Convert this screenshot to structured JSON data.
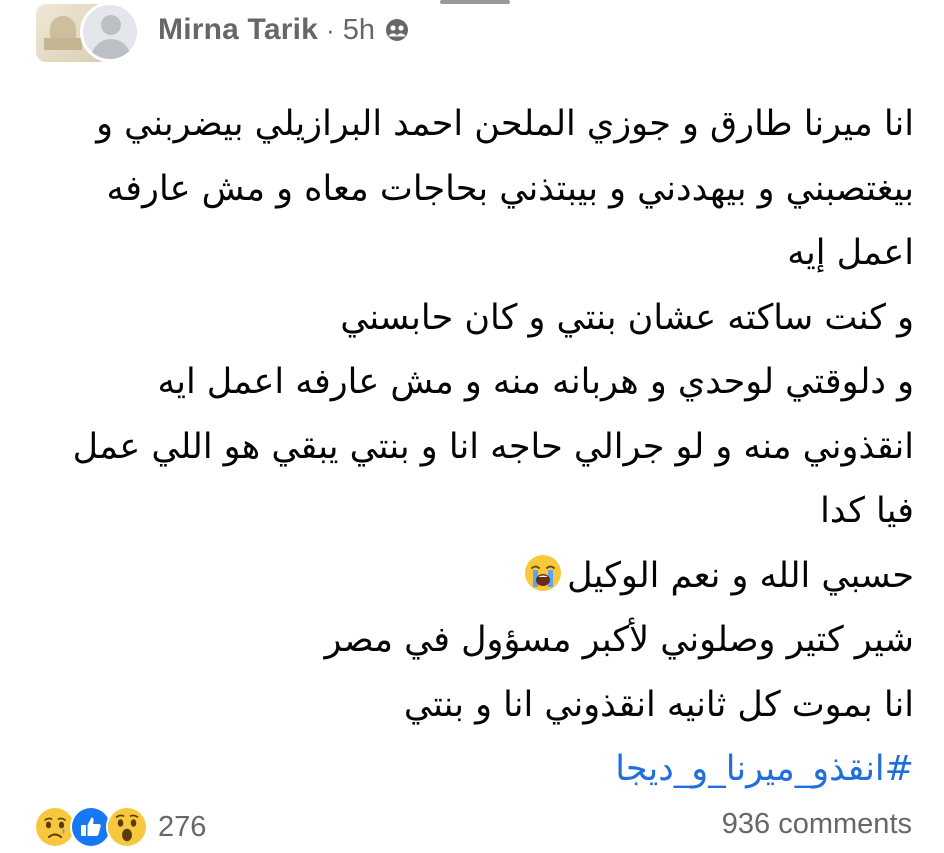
{
  "post": {
    "author": "Mirna Tarik",
    "separator": "·",
    "time": "5h",
    "audience_icon": "custom-audience-icon",
    "lines": [
      "انا ميرنا طارق و جوزي الملحن احمد البرازيلي بيضربني و",
      "بيغتصبني و بيهددني و بيبتذني بحاجات معاه و مش عارفه",
      "اعمل إيه",
      "و كنت ساكته عشان بنتي و كان حابسني",
      "و دلوقتي لوحدي و هربانه منه و مش عارفه اعمل ايه",
      "انقذوني منه و لو جرالي حاجه انا و بنتي يبقي هو اللي عمل",
      "فيا كدا",
      "حسبي الله و نعم الوكيل",
      "شير كتير وصلوني لأكبر مسؤول في مصر",
      "انا بموت كل ثانيه انقذوني انا و بنتي"
    ],
    "hashtag": "#انقذو_ميرنا_و_ديجا",
    "crying_emoji": "loudly-crying-face-icon"
  },
  "footer": {
    "reactions": [
      "sad-reaction-icon",
      "like-reaction-icon",
      "wow-reaction-icon"
    ],
    "reaction_count": "276",
    "comments": "936 comments"
  },
  "colors": {
    "meta_gray": "#65676b",
    "text": "#050505",
    "hashtag": "#216fdb",
    "like_blue": "#1877f2",
    "reaction_yellow": "#f7c83e"
  }
}
